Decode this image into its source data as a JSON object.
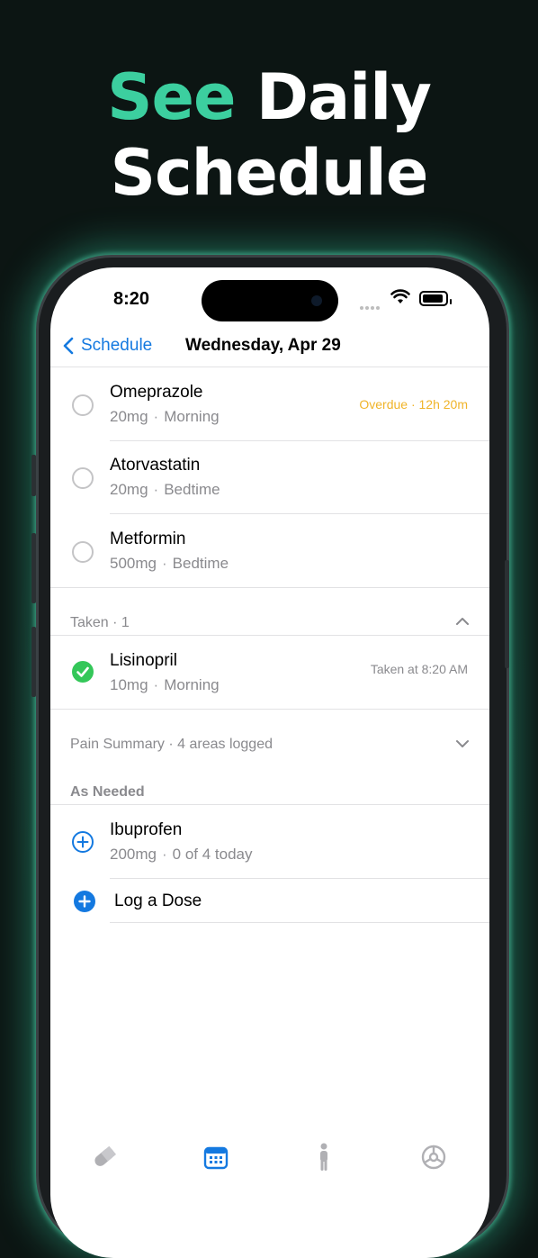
{
  "headline": {
    "accent": "See",
    "rest": "Daily",
    "line2": "Schedule"
  },
  "colors": {
    "accent": "#3ccf9f",
    "blue": "#1479e0",
    "overdue": "#f0b429",
    "taken": "#34c759"
  },
  "status": {
    "time": "8:20"
  },
  "nav": {
    "back_label": "Schedule",
    "title": "Wednesday, Apr 29"
  },
  "scheduled": [
    {
      "name": "Omeprazole",
      "dose": "20mg",
      "time": "Morning",
      "status": "Overdue · 12h 20m"
    },
    {
      "name": "Atorvastatin",
      "dose": "20mg",
      "time": "Bedtime",
      "status": ""
    },
    {
      "name": "Metformin",
      "dose": "500mg",
      "time": "Bedtime",
      "status": ""
    }
  ],
  "taken_section": {
    "label": "Taken · 1"
  },
  "taken": [
    {
      "name": "Lisinopril",
      "dose": "10mg",
      "time": "Morning",
      "status": "Taken at 8:20 AM"
    }
  ],
  "pain_summary": {
    "label": "Pain Summary · 4 areas logged"
  },
  "as_needed_section": {
    "label": "As Needed"
  },
  "as_needed": [
    {
      "name": "Ibuprofen",
      "dose": "200mg",
      "count": "0 of 4 today"
    }
  ],
  "log_dose": {
    "label": "Log a Dose"
  },
  "tabs": [
    {
      "icon": "pill-icon"
    },
    {
      "icon": "calendar-icon"
    },
    {
      "icon": "person-icon"
    },
    {
      "icon": "settings-icon"
    }
  ]
}
